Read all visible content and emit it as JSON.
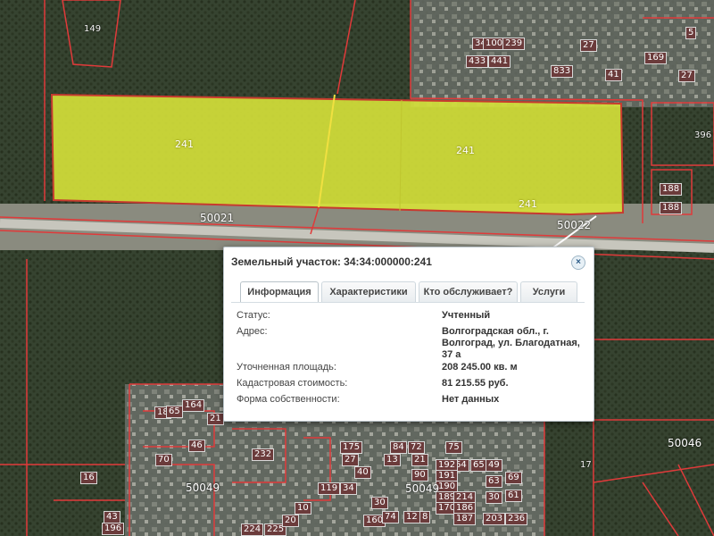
{
  "map": {
    "parcel_labels": [
      "149",
      "241",
      "241",
      "241",
      "396",
      "188",
      "188",
      "164",
      "232",
      "17"
    ],
    "small_labels": [
      "433",
      "441",
      "346",
      "100",
      "239",
      "27",
      "833",
      "41",
      "169",
      "27",
      "5",
      "18",
      "21",
      "65",
      "84",
      "72",
      "75",
      "64",
      "65",
      "49",
      "63",
      "69",
      "30",
      "61",
      "119",
      "192",
      "191",
      "190",
      "189",
      "170",
      "214",
      "186",
      "187",
      "203",
      "236",
      "43",
      "196",
      "224",
      "225",
      "160",
      "16",
      "175",
      "27",
      "40",
      "34",
      "8",
      "12",
      "10",
      "20",
      "70",
      "46",
      "13",
      "21",
      "30",
      "74",
      "90"
    ],
    "road_labels": [
      "50021",
      "50022",
      "50046",
      "50049",
      "50049"
    ]
  },
  "popup": {
    "title": "Земельный участок: 34:34:000000:241",
    "close_glyph": "×",
    "tabs": [
      "Информация",
      "Характеристики",
      "Кто обслуживает?",
      "Услуги"
    ],
    "active_tab": 0,
    "rows": [
      {
        "label": "Статус:",
        "value": "Учтенный"
      },
      {
        "label": "Адрес:",
        "value": "Волгоградская обл., г. Волгоград, ул. Благодатная, 37 а"
      },
      {
        "label": "Уточненная площадь:",
        "value": "208 245.00 кв. м"
      },
      {
        "label": "Кадастровая стоимость:",
        "value": "81 215.55 руб."
      },
      {
        "label": "Форма собственности:",
        "value": "Нет данных"
      }
    ]
  },
  "colors": {
    "parcel_fill": "#d6e23a",
    "boundary": "#e03a3a",
    "popup_accent": "#2b5b87"
  }
}
